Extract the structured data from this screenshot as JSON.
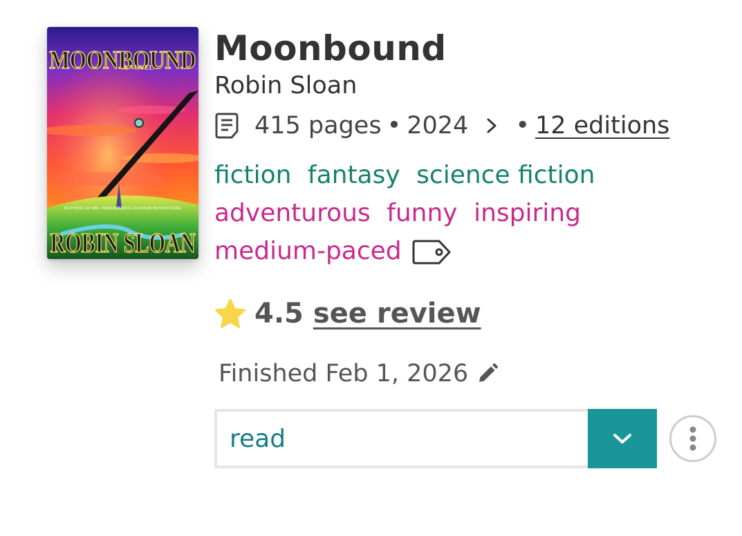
{
  "book": {
    "title": "Moonbound",
    "author": "Robin Sloan",
    "pages": "415 pages",
    "bullet": "•",
    "year": "2024",
    "editions": "12 editions",
    "cover": {
      "title_text": "MOONBOUND",
      "subtitle_text": "A NOVEL",
      "author_text": "ROBIN SLOAN",
      "tagline_text": "AUTHOR OF MR. PENUMBRA'S 24-HOUR BOOKSTORE"
    }
  },
  "tags": {
    "genres": [
      "fiction",
      "fantasy",
      "science fiction"
    ],
    "moods": [
      "adventurous",
      "funny",
      "inspiring"
    ],
    "pace": "medium-paced"
  },
  "rating": {
    "value": "4.5",
    "review_link": "see review"
  },
  "finished": {
    "label": "Finished Feb 1, 2026"
  },
  "status": {
    "selected": "read"
  },
  "icons": {
    "pages": "book-pages-icon",
    "chevron": "chevron-right-icon",
    "tag": "tag-icon",
    "star": "star-icon",
    "edit": "pencil-icon",
    "dropdown": "chevron-down-icon",
    "more": "more-vertical-icon"
  },
  "colors": {
    "genre": "#15826a",
    "mood": "#c72a8c",
    "star": "#f9d649",
    "accent": "#1a9599",
    "status_text": "#157e86"
  }
}
